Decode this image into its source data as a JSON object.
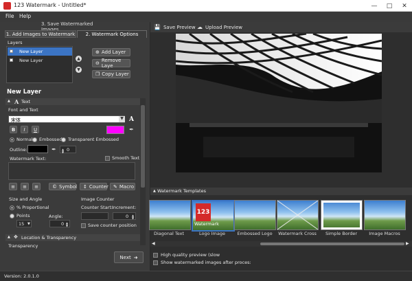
{
  "window": {
    "title": "123 Watermark - Untitled*"
  },
  "menu": {
    "file": "File",
    "help": "Help"
  },
  "steps": {
    "step3": "3. Save Watermarked Images",
    "step1": "1. Add Images to Watermark",
    "step2": "2. Watermark Options"
  },
  "layers": {
    "heading": "Layers",
    "items": [
      {
        "label": "New Layer"
      },
      {
        "label": "New Layer"
      }
    ],
    "add": "Add Layer",
    "remove": "Remove Laye",
    "copy": "Copy Layer"
  },
  "layer_title": "New Layer",
  "text_section": {
    "header": "Text",
    "font_and_text": "Font and Text",
    "font_value": "宋体",
    "style": {
      "normal": "Normal",
      "embossed": "Embossed",
      "transparent": "Transparent Embossed"
    },
    "outline_label": "Outline:",
    "outline_value": "0",
    "watermark_text_label": "Watermark Text:",
    "smooth_text": "Smooth Text",
    "symbol": "Symbol",
    "counter": "Counter",
    "macro": "Macro",
    "color_swatch": "#ff00ff"
  },
  "size_angle": {
    "heading": "Size and Angle",
    "proportional": "% Proportional",
    "points": "Points",
    "size_value": "15",
    "angle_label": "Angle:",
    "angle_value": "0"
  },
  "image_counter": {
    "heading": "Image Counter",
    "counter_start": "Counter Start:",
    "increment": "Increment:",
    "increment_value": "0",
    "save_position": "Save counter position"
  },
  "location": {
    "header": "Location & Transparency",
    "transparency": "Transparency"
  },
  "next_button": "Next",
  "preview": {
    "save": "Save Preview",
    "upload": "Upload Preview"
  },
  "templates": {
    "header": "Watermark Templates",
    "items": [
      {
        "label": "Diagonal Text"
      },
      {
        "label": "Logo Image"
      },
      {
        "label": "Embossed Logo"
      },
      {
        "label": "Watermark Cross"
      },
      {
        "label": "Simple Border"
      },
      {
        "label": "Image Macros"
      }
    ],
    "logo_badge": "123",
    "logo_caption": "Watermark"
  },
  "options": {
    "high_quality": "High quality preview (slow",
    "show_after": "Show watermarked images after proces:"
  },
  "status": {
    "version": "Version: 2.0.1.0"
  }
}
